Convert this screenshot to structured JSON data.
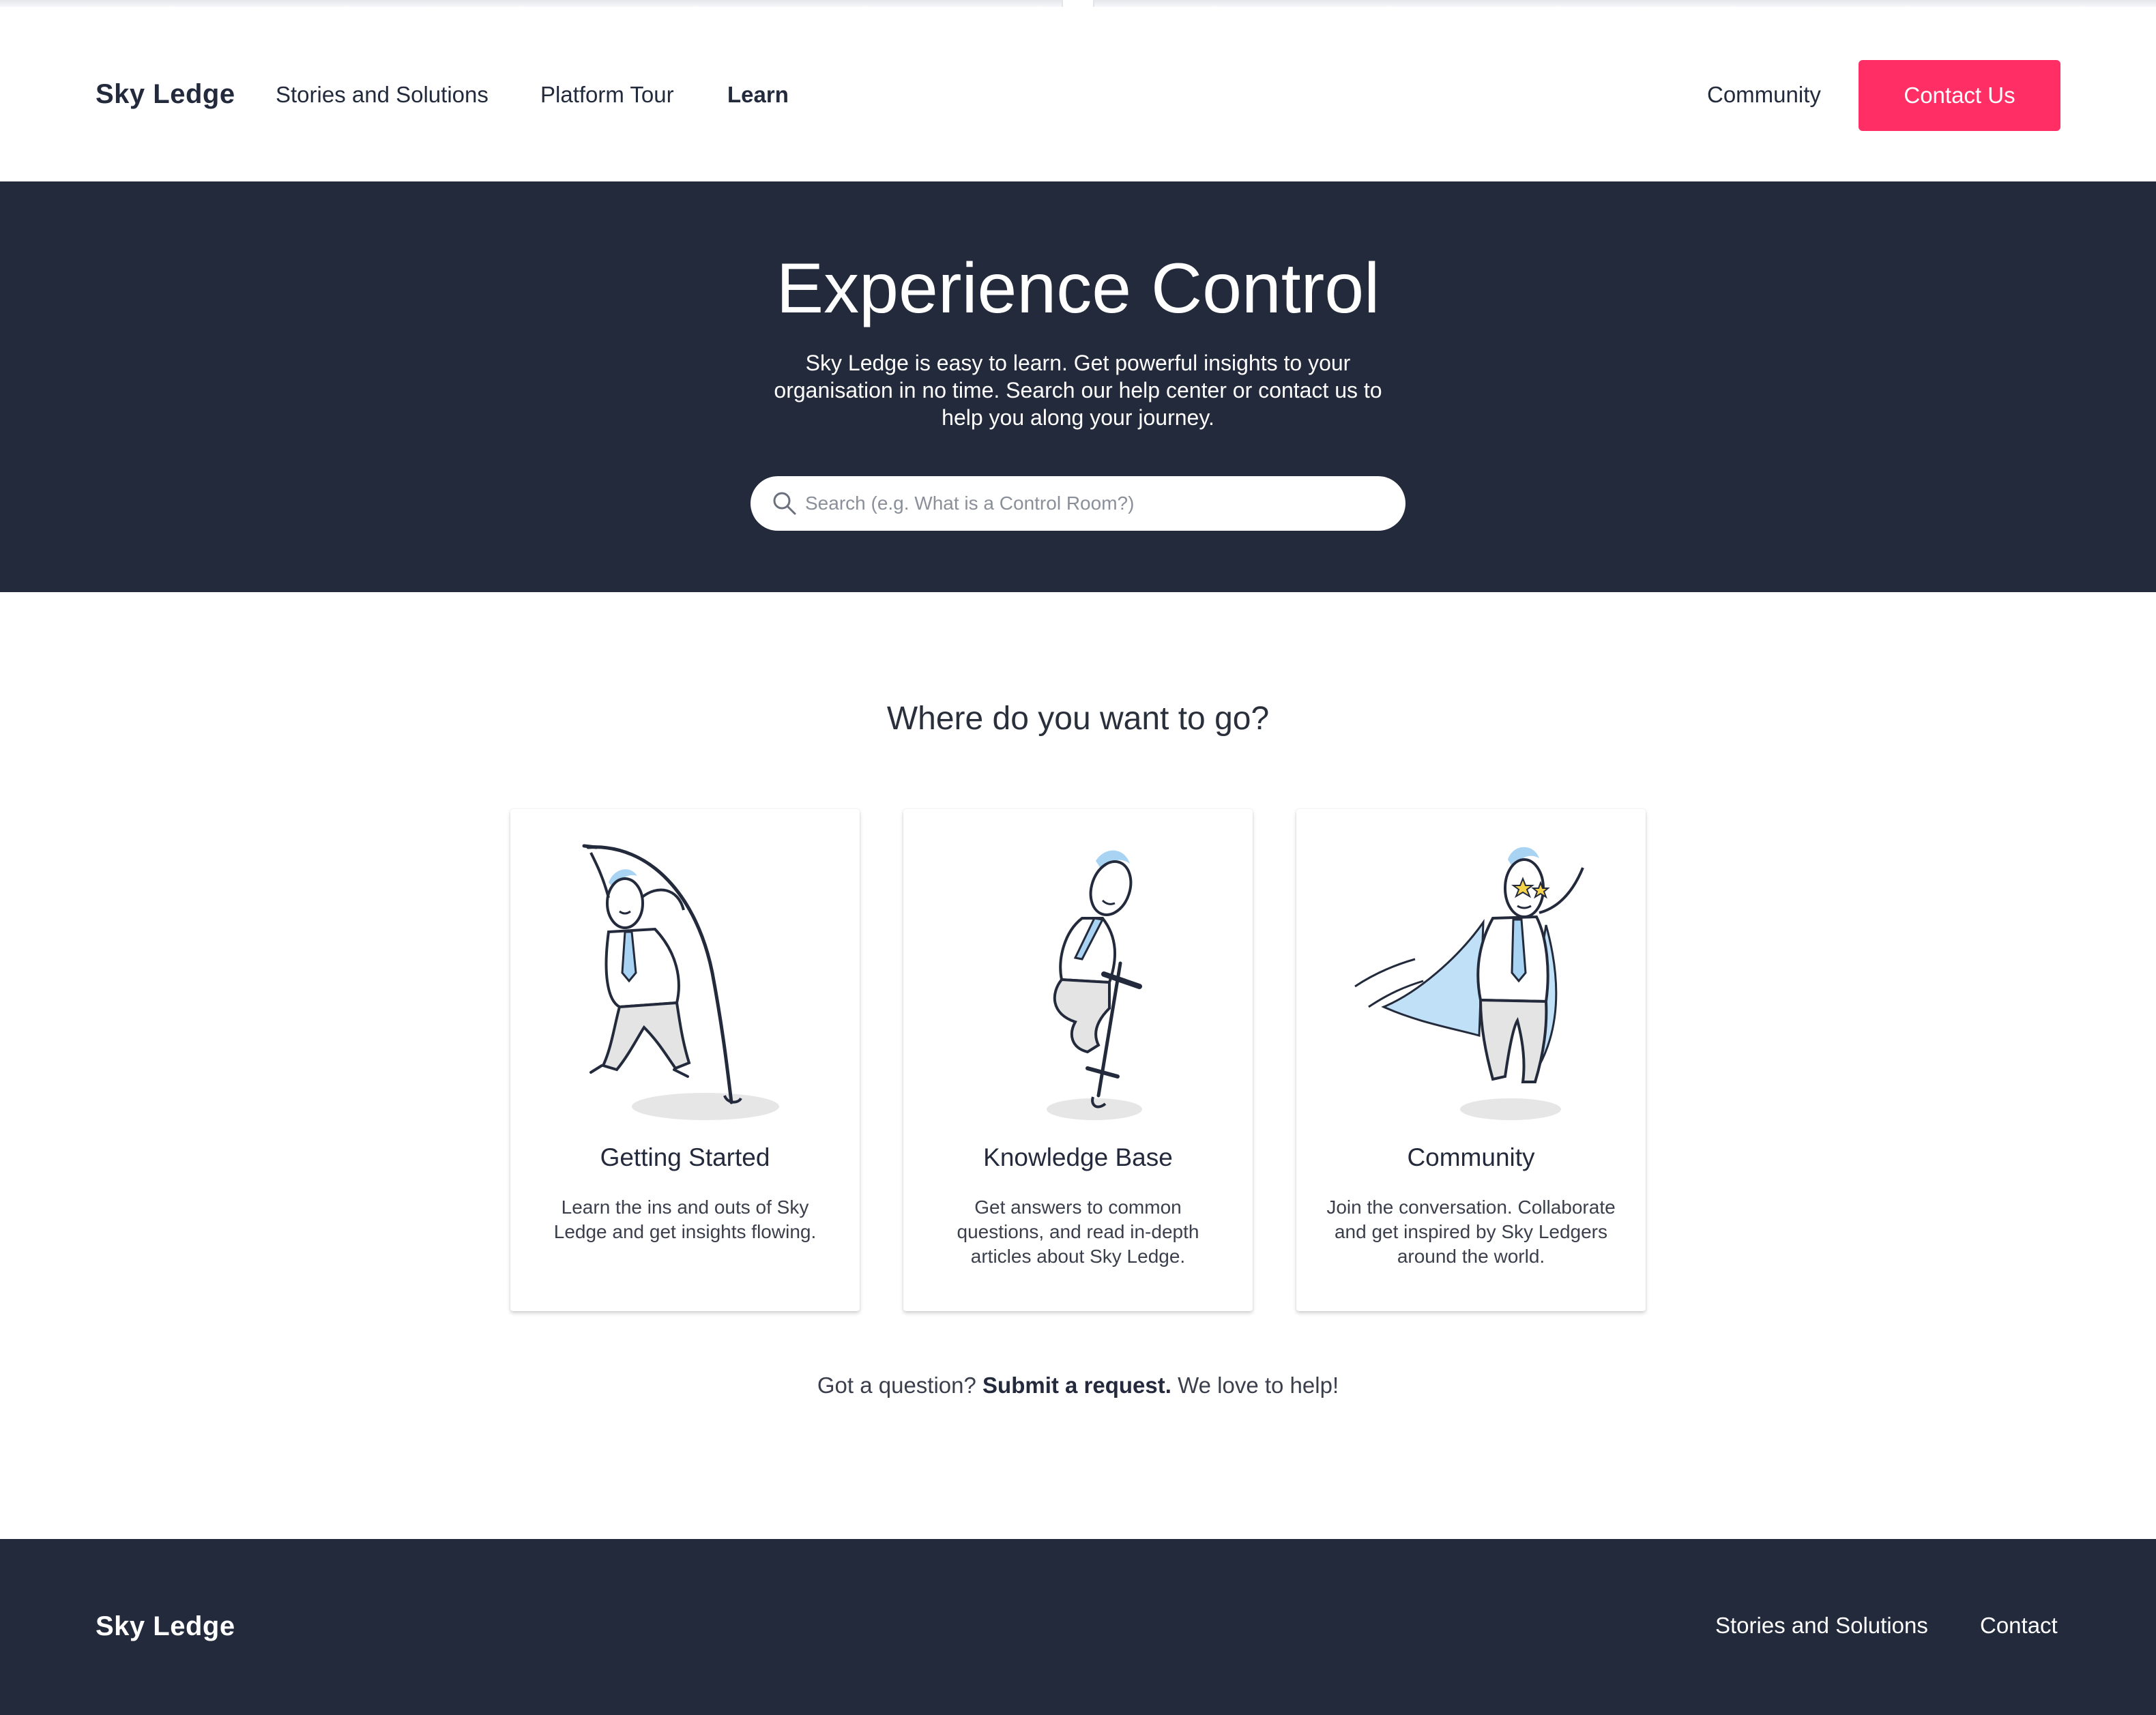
{
  "header": {
    "logo": "Sky Ledge",
    "nav": {
      "stories": "Stories and Solutions",
      "tour": "Platform Tour",
      "learn": "Learn",
      "community": "Community"
    },
    "contact_button": "Contact Us"
  },
  "hero": {
    "title": "Experience Control",
    "subtitle": "Sky Ledge is easy to learn. Get powerful insights to your organisation in no time. Search our help center or contact us to help you along your journey.",
    "search_placeholder": "Search (e.g. What is a Control Room?)"
  },
  "main": {
    "section_title": "Where do you want to go?",
    "cards": [
      {
        "title": "Getting Started",
        "description": "Learn the ins and outs of Sky Ledge and get insights flowing."
      },
      {
        "title": "Knowledge Base",
        "description": "Get answers to common questions, and read in-depth articles about Sky Ledge."
      },
      {
        "title": "Community",
        "description": "Join the conversation. Collaborate and get inspired by Sky Ledgers around the world."
      }
    ],
    "question": {
      "prefix": "Got a question?",
      "link": "Submit a request.",
      "suffix": "We love to help!"
    }
  },
  "footer": {
    "logo": "Sky Ledge",
    "links": {
      "stories": "Stories and Solutions",
      "contact": "Contact"
    }
  },
  "colors": {
    "navy": "#232a3b",
    "accent": "#ff2f66",
    "illustration_blue": "#a9d3f2"
  },
  "icons": {
    "search": "search-icon"
  }
}
